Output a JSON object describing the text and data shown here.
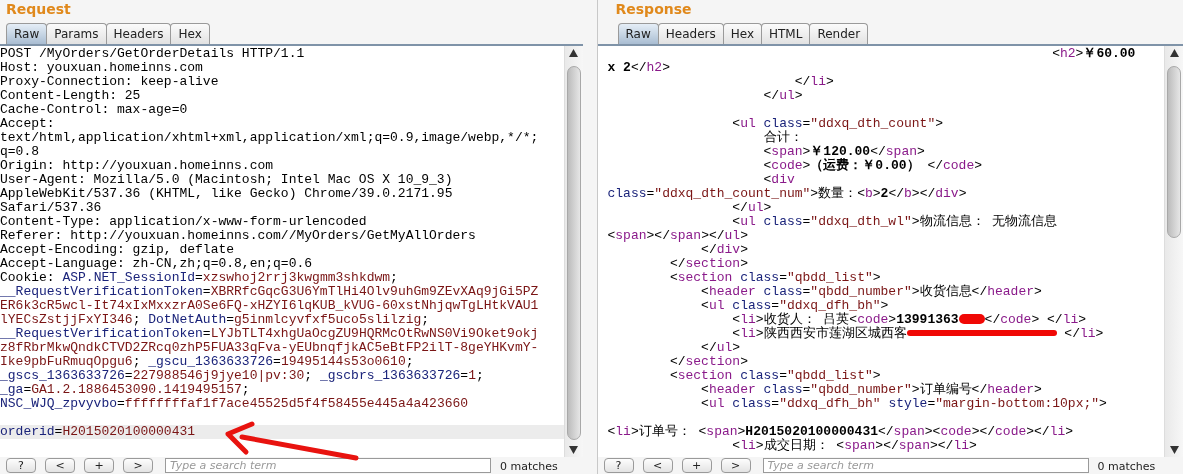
{
  "panels": [
    {
      "title": "Request",
      "tabs": [
        {
          "label": "Raw",
          "selected": true
        },
        {
          "label": "Params",
          "selected": false
        },
        {
          "label": "Headers",
          "selected": false
        },
        {
          "label": "Hex",
          "selected": false
        }
      ],
      "lines": [
        {
          "kind": "code",
          "highlighted": false,
          "tokens": [
            {
              "kind": "plain",
              "text": "POST /MyOrders/GetOrderDetails HTTP/1.1"
            }
          ]
        },
        {
          "kind": "code",
          "highlighted": false,
          "tokens": [
            {
              "kind": "plain",
              "text": "Host: youxuan.homeinns.com"
            }
          ]
        },
        {
          "kind": "code",
          "highlighted": false,
          "tokens": [
            {
              "kind": "plain",
              "text": "Proxy-Connection: keep-alive"
            }
          ]
        },
        {
          "kind": "code",
          "highlighted": false,
          "tokens": [
            {
              "kind": "plain",
              "text": "Content-Length: 25"
            }
          ]
        },
        {
          "kind": "code",
          "highlighted": false,
          "tokens": [
            {
              "kind": "plain",
              "text": "Cache-Control: max-age=0"
            }
          ]
        },
        {
          "kind": "code",
          "highlighted": false,
          "tokens": [
            {
              "kind": "plain",
              "text": "Accept:"
            }
          ]
        },
        {
          "kind": "code",
          "highlighted": false,
          "tokens": [
            {
              "kind": "plain",
              "text": "text/html,application/xhtml+xml,application/xml;q=0.9,image/webp,*/*;"
            }
          ]
        },
        {
          "kind": "code",
          "highlighted": false,
          "tokens": [
            {
              "kind": "plain",
              "text": "q=0.8"
            }
          ]
        },
        {
          "kind": "code",
          "highlighted": false,
          "tokens": [
            {
              "kind": "plain",
              "text": "Origin: http://youxuan.homeinns.com"
            }
          ]
        },
        {
          "kind": "code",
          "highlighted": false,
          "tokens": [
            {
              "kind": "plain",
              "text": "User-Agent: Mozilla/5.0 (Macintosh; Intel Mac OS X 10_9_3)"
            }
          ]
        },
        {
          "kind": "code",
          "highlighted": false,
          "tokens": [
            {
              "kind": "plain",
              "text": "AppleWebKit/537.36 (KHTML, like Gecko) Chrome/39.0.2171.95"
            }
          ]
        },
        {
          "kind": "code",
          "highlighted": false,
          "tokens": [
            {
              "kind": "plain",
              "text": "Safari/537.36"
            }
          ]
        },
        {
          "kind": "code",
          "highlighted": false,
          "tokens": [
            {
              "kind": "plain",
              "text": "Content-Type: application/x-www-form-urlencoded"
            }
          ]
        },
        {
          "kind": "code",
          "highlighted": false,
          "tokens": [
            {
              "kind": "plain",
              "text": "Referer: http://youxuan.homeinns.com//MyOrders/GetMyAllOrders"
            }
          ]
        },
        {
          "kind": "code",
          "highlighted": false,
          "tokens": [
            {
              "kind": "plain",
              "text": "Accept-Encoding: gzip, deflate"
            }
          ]
        },
        {
          "kind": "code",
          "highlighted": false,
          "tokens": [
            {
              "kind": "plain",
              "text": "Accept-Language: zh-CN,zh;q=0.8,en;q=0.6"
            }
          ]
        },
        {
          "kind": "code",
          "highlighted": false,
          "tokens": [
            {
              "kind": "plain",
              "text": "Cookie: "
            },
            {
              "kind": "name",
              "text": "ASP.NET_SessionId"
            },
            {
              "kind": "plain",
              "text": "="
            },
            {
              "kind": "value",
              "text": "xzswhoj2rrj3kwgmm3shkdwm"
            },
            {
              "kind": "plain",
              "text": ";"
            }
          ]
        },
        {
          "kind": "code",
          "highlighted": false,
          "tokens": [
            {
              "kind": "name",
              "text": "__RequestVerificationToken"
            },
            {
              "kind": "plain",
              "text": "="
            },
            {
              "kind": "value",
              "text": "XBRRfcGqcG3U6YmTlHi4Olv9uhGm9ZEvXAq9jGi5PZ"
            }
          ]
        },
        {
          "kind": "code",
          "highlighted": false,
          "tokens": [
            {
              "kind": "value",
              "text": "ER6k3cR5wcl-It74xIxMxxzrA0Se6FQ-xHZYI6lqKUB_kVUG-60xstNhjqwTgLHtkVAU1"
            }
          ]
        },
        {
          "kind": "code",
          "highlighted": false,
          "tokens": [
            {
              "kind": "value",
              "text": "lYECsZstjjFxYI346"
            },
            {
              "kind": "plain",
              "text": "; "
            },
            {
              "kind": "name",
              "text": "DotNetAuth"
            },
            {
              "kind": "plain",
              "text": "="
            },
            {
              "kind": "value",
              "text": "g5inmlcyvfxf5uco5slilzig"
            },
            {
              "kind": "plain",
              "text": ";"
            }
          ]
        },
        {
          "kind": "code",
          "highlighted": false,
          "tokens": [
            {
              "kind": "name",
              "text": "__RequestVerificationToken"
            },
            {
              "kind": "plain",
              "text": "="
            },
            {
              "kind": "value",
              "text": "LYJbTLT4xhgUaOcgZU9HQRMcOtRwNS0Vi9Oket9okj"
            }
          ]
        },
        {
          "kind": "code",
          "highlighted": false,
          "tokens": [
            {
              "kind": "value",
              "text": "z8fRbrMkwQndkCTVD2ZRcq0zhP5FUA33qFva-yEUbnqfjkAC5eBtFP2ilT-8geYHKvmY-"
            }
          ]
        },
        {
          "kind": "code",
          "highlighted": false,
          "tokens": [
            {
              "kind": "value",
              "text": "Ike9pbFuRmuqOpgu6"
            },
            {
              "kind": "plain",
              "text": "; "
            },
            {
              "kind": "name",
              "text": "_gscu_1363633726"
            },
            {
              "kind": "plain",
              "text": "="
            },
            {
              "kind": "value",
              "text": "19495144s53o0610"
            },
            {
              "kind": "plain",
              "text": ";"
            }
          ]
        },
        {
          "kind": "code",
          "highlighted": false,
          "tokens": [
            {
              "kind": "name",
              "text": "_gscs_1363633726"
            },
            {
              "kind": "plain",
              "text": "="
            },
            {
              "kind": "value",
              "text": "227988546j9jye10|pv:30"
            },
            {
              "kind": "plain",
              "text": "; "
            },
            {
              "kind": "name",
              "text": "_gscbrs_1363633726"
            },
            {
              "kind": "plain",
              "text": "="
            },
            {
              "kind": "value",
              "text": "1"
            },
            {
              "kind": "plain",
              "text": ";"
            }
          ]
        },
        {
          "kind": "code",
          "highlighted": false,
          "tokens": [
            {
              "kind": "name",
              "text": "_ga"
            },
            {
              "kind": "plain",
              "text": "="
            },
            {
              "kind": "value",
              "text": "GA1.2.1886453090.1419495157"
            },
            {
              "kind": "plain",
              "text": ";"
            }
          ]
        },
        {
          "kind": "code",
          "highlighted": false,
          "tokens": [
            {
              "kind": "name",
              "text": "NSC_WJQ_zpvyvbo"
            },
            {
              "kind": "plain",
              "text": "="
            },
            {
              "kind": "value",
              "text": "ffffffffaf1f7ace45525d5f4f58455e445a4a423660"
            }
          ]
        },
        {
          "kind": "blank"
        },
        {
          "kind": "code",
          "highlighted": true,
          "tokens": [
            {
              "kind": "name",
              "text": "orderid"
            },
            {
              "kind": "plain",
              "text": "="
            },
            {
              "kind": "value",
              "text": "H2015020100000431"
            }
          ]
        }
      ],
      "buttons": [
        "?",
        "<",
        "+",
        ">"
      ],
      "search": {
        "placeholder": "Type a search term"
      },
      "matches": "0 matches"
    },
    {
      "title": "Response",
      "tabs": [
        {
          "label": "Raw",
          "selected": true
        },
        {
          "label": "Headers",
          "selected": false
        },
        {
          "label": "Hex",
          "selected": false
        },
        {
          "label": "HTML",
          "selected": false
        },
        {
          "label": "Render",
          "selected": false
        }
      ],
      "lines": [
        {
          "kind": "code",
          "highlighted": false,
          "tokens": [
            {
              "kind": "plain",
              "text": "                                                         <"
            },
            {
              "kind": "tag",
              "text": "h2"
            },
            {
              "kind": "plain",
              "text": ">"
            },
            {
              "kind": "bold",
              "text": "￥60.00"
            }
          ]
        },
        {
          "kind": "code",
          "highlighted": false,
          "tokens": [
            {
              "kind": "bold",
              "text": "x 2"
            },
            {
              "kind": "plain",
              "text": "</"
            },
            {
              "kind": "tag",
              "text": "h2"
            },
            {
              "kind": "plain",
              "text": ">"
            }
          ]
        },
        {
          "kind": "code",
          "highlighted": false,
          "tokens": [
            {
              "kind": "plain",
              "text": "                        </"
            },
            {
              "kind": "tag",
              "text": "li"
            },
            {
              "kind": "plain",
              "text": ">"
            }
          ]
        },
        {
          "kind": "code",
          "highlighted": false,
          "tokens": [
            {
              "kind": "plain",
              "text": "                    </"
            },
            {
              "kind": "tag",
              "text": "ul"
            },
            {
              "kind": "plain",
              "text": ">"
            }
          ]
        },
        {
          "kind": "blank"
        },
        {
          "kind": "code",
          "highlighted": false,
          "tokens": [
            {
              "kind": "plain",
              "text": "                <"
            },
            {
              "kind": "tag",
              "text": "ul"
            },
            {
              "kind": "name",
              "text": " class"
            },
            {
              "kind": "plain",
              "text": "="
            },
            {
              "kind": "value",
              "text": "\"ddxq_dth_count\""
            },
            {
              "kind": "plain",
              "text": ">"
            }
          ]
        },
        {
          "kind": "code",
          "highlighted": false,
          "tokens": [
            {
              "kind": "plain",
              "text": "                    合计："
            }
          ]
        },
        {
          "kind": "code",
          "highlighted": false,
          "tokens": [
            {
              "kind": "plain",
              "text": "                    <"
            },
            {
              "kind": "tag",
              "text": "span"
            },
            {
              "kind": "plain",
              "text": ">"
            },
            {
              "kind": "bold",
              "text": "￥120.00"
            },
            {
              "kind": "plain",
              "text": "</"
            },
            {
              "kind": "tag",
              "text": "span"
            },
            {
              "kind": "plain",
              "text": ">"
            }
          ]
        },
        {
          "kind": "code",
          "highlighted": false,
          "tokens": [
            {
              "kind": "plain",
              "text": "                    <"
            },
            {
              "kind": "tag",
              "text": "code"
            },
            {
              "kind": "plain",
              "text": ">"
            },
            {
              "kind": "bold",
              "text": "（运费：￥0.00）"
            },
            {
              "kind": "plain",
              "text": " </"
            },
            {
              "kind": "tag",
              "text": "code"
            },
            {
              "kind": "plain",
              "text": ">"
            }
          ]
        },
        {
          "kind": "code",
          "highlighted": false,
          "tokens": [
            {
              "kind": "plain",
              "text": "                    <"
            },
            {
              "kind": "tag",
              "text": "div"
            }
          ]
        },
        {
          "kind": "code",
          "highlighted": false,
          "tokens": [
            {
              "kind": "name",
              "text": "class"
            },
            {
              "kind": "plain",
              "text": "="
            },
            {
              "kind": "value",
              "text": "\"ddxq_dth_count_num\""
            },
            {
              "kind": "plain",
              "text": ">数量：<"
            },
            {
              "kind": "tag",
              "text": "b"
            },
            {
              "kind": "plain",
              "text": ">"
            },
            {
              "kind": "bold",
              "text": "2"
            },
            {
              "kind": "plain",
              "text": "</"
            },
            {
              "kind": "tag",
              "text": "b"
            },
            {
              "kind": "plain",
              "text": "></"
            },
            {
              "kind": "tag",
              "text": "div"
            },
            {
              "kind": "plain",
              "text": ">"
            }
          ]
        },
        {
          "kind": "code",
          "highlighted": false,
          "tokens": [
            {
              "kind": "plain",
              "text": "                </"
            },
            {
              "kind": "tag",
              "text": "ul"
            },
            {
              "kind": "plain",
              "text": ">"
            }
          ]
        },
        {
          "kind": "code",
          "highlighted": false,
          "tokens": [
            {
              "kind": "plain",
              "text": "                <"
            },
            {
              "kind": "tag",
              "text": "ul"
            },
            {
              "kind": "name",
              "text": " class"
            },
            {
              "kind": "plain",
              "text": "="
            },
            {
              "kind": "value",
              "text": "\"ddxq_dth_wl\""
            },
            {
              "kind": "plain",
              "text": ">物流信息： 无物流信息"
            }
          ]
        },
        {
          "kind": "code",
          "highlighted": false,
          "tokens": [
            {
              "kind": "plain",
              "text": "<"
            },
            {
              "kind": "tag",
              "text": "span"
            },
            {
              "kind": "plain",
              "text": "></"
            },
            {
              "kind": "tag",
              "text": "span"
            },
            {
              "kind": "plain",
              "text": "></"
            },
            {
              "kind": "tag",
              "text": "ul"
            },
            {
              "kind": "plain",
              "text": ">"
            }
          ]
        },
        {
          "kind": "code",
          "highlighted": false,
          "tokens": [
            {
              "kind": "plain",
              "text": "            </"
            },
            {
              "kind": "tag",
              "text": "div"
            },
            {
              "kind": "plain",
              "text": ">"
            }
          ]
        },
        {
          "kind": "code",
          "highlighted": false,
          "tokens": [
            {
              "kind": "plain",
              "text": "        </"
            },
            {
              "kind": "tag",
              "text": "section"
            },
            {
              "kind": "plain",
              "text": ">"
            }
          ]
        },
        {
          "kind": "code",
          "highlighted": false,
          "tokens": [
            {
              "kind": "plain",
              "text": "        <"
            },
            {
              "kind": "tag",
              "text": "section"
            },
            {
              "kind": "name",
              "text": " class"
            },
            {
              "kind": "plain",
              "text": "="
            },
            {
              "kind": "value",
              "text": "\"qbdd_list\""
            },
            {
              "kind": "plain",
              "text": ">"
            }
          ]
        },
        {
          "kind": "code",
          "highlighted": false,
          "tokens": [
            {
              "kind": "plain",
              "text": "            <"
            },
            {
              "kind": "tag",
              "text": "header"
            },
            {
              "kind": "name",
              "text": " class"
            },
            {
              "kind": "plain",
              "text": "="
            },
            {
              "kind": "value",
              "text": "\"qbdd_number\""
            },
            {
              "kind": "plain",
              "text": ">收货信息</"
            },
            {
              "kind": "tag",
              "text": "header"
            },
            {
              "kind": "plain",
              "text": ">"
            }
          ]
        },
        {
          "kind": "code",
          "highlighted": false,
          "tokens": [
            {
              "kind": "plain",
              "text": "            <"
            },
            {
              "kind": "tag",
              "text": "ul"
            },
            {
              "kind": "name",
              "text": " class"
            },
            {
              "kind": "plain",
              "text": "="
            },
            {
              "kind": "value",
              "text": "\"ddxq_dfh_bh\""
            },
            {
              "kind": "plain",
              "text": ">"
            }
          ]
        },
        {
          "kind": "code",
          "highlighted": false,
          "tokens": [
            {
              "kind": "plain",
              "text": "                <"
            },
            {
              "kind": "tag",
              "text": "li"
            },
            {
              "kind": "plain",
              "text": ">收货人： 吕英<"
            },
            {
              "kind": "tag",
              "text": "code"
            },
            {
              "kind": "plain",
              "text": ">"
            },
            {
              "kind": "bold",
              "text": "13991363"
            },
            {
              "kind": "blob"
            },
            {
              "kind": "plain",
              "text": "</"
            },
            {
              "kind": "tag",
              "text": "code"
            },
            {
              "kind": "plain",
              "text": "> </"
            },
            {
              "kind": "tag",
              "text": "li"
            },
            {
              "kind": "plain",
              "text": ">"
            }
          ]
        },
        {
          "kind": "code",
          "highlighted": false,
          "tokens": [
            {
              "kind": "plain",
              "text": "                <"
            },
            {
              "kind": "tag",
              "text": "li"
            },
            {
              "kind": "plain",
              "text": ">陕西西安市莲湖区城西客"
            },
            {
              "kind": "stroke"
            },
            {
              "kind": "plain",
              "text": " </"
            },
            {
              "kind": "tag",
              "text": "li"
            },
            {
              "kind": "plain",
              "text": ">"
            }
          ]
        },
        {
          "kind": "code",
          "highlighted": false,
          "tokens": [
            {
              "kind": "plain",
              "text": "            </"
            },
            {
              "kind": "tag",
              "text": "ul"
            },
            {
              "kind": "plain",
              "text": ">"
            }
          ]
        },
        {
          "kind": "code",
          "highlighted": false,
          "tokens": [
            {
              "kind": "plain",
              "text": "        </"
            },
            {
              "kind": "tag",
              "text": "section"
            },
            {
              "kind": "plain",
              "text": ">"
            }
          ]
        },
        {
          "kind": "code",
          "highlighted": false,
          "tokens": [
            {
              "kind": "plain",
              "text": "        <"
            },
            {
              "kind": "tag",
              "text": "section"
            },
            {
              "kind": "name",
              "text": " class"
            },
            {
              "kind": "plain",
              "text": "="
            },
            {
              "kind": "value",
              "text": "\"qbdd_list\""
            },
            {
              "kind": "plain",
              "text": ">"
            }
          ]
        },
        {
          "kind": "code",
          "highlighted": false,
          "tokens": [
            {
              "kind": "plain",
              "text": "            <"
            },
            {
              "kind": "tag",
              "text": "header"
            },
            {
              "kind": "name",
              "text": " class"
            },
            {
              "kind": "plain",
              "text": "="
            },
            {
              "kind": "value",
              "text": "\"qbdd_number\""
            },
            {
              "kind": "plain",
              "text": ">订单编号</"
            },
            {
              "kind": "tag",
              "text": "header"
            },
            {
              "kind": "plain",
              "text": ">"
            }
          ]
        },
        {
          "kind": "code",
          "highlighted": false,
          "tokens": [
            {
              "kind": "plain",
              "text": "            <"
            },
            {
              "kind": "tag",
              "text": "ul"
            },
            {
              "kind": "name",
              "text": " class"
            },
            {
              "kind": "plain",
              "text": "="
            },
            {
              "kind": "value",
              "text": "\"ddxq_dfh_bh\""
            },
            {
              "kind": "name",
              "text": " style"
            },
            {
              "kind": "plain",
              "text": "="
            },
            {
              "kind": "value",
              "text": "\"margin-bottom:10px;\""
            },
            {
              "kind": "plain",
              "text": ">"
            }
          ]
        },
        {
          "kind": "blank"
        },
        {
          "kind": "code",
          "highlighted": false,
          "tokens": [
            {
              "kind": "plain",
              "text": "<"
            },
            {
              "kind": "tag",
              "text": "li"
            },
            {
              "kind": "plain",
              "text": ">订单号： <"
            },
            {
              "kind": "tag",
              "text": "span"
            },
            {
              "kind": "plain",
              "text": ">"
            },
            {
              "kind": "bold",
              "text": "H2015020100000431"
            },
            {
              "kind": "plain",
              "text": "</"
            },
            {
              "kind": "tag",
              "text": "span"
            },
            {
              "kind": "plain",
              "text": "><"
            },
            {
              "kind": "tag",
              "text": "code"
            },
            {
              "kind": "plain",
              "text": "></"
            },
            {
              "kind": "tag",
              "text": "code"
            },
            {
              "kind": "plain",
              "text": "></"
            },
            {
              "kind": "tag",
              "text": "li"
            },
            {
              "kind": "plain",
              "text": ">"
            }
          ]
        },
        {
          "kind": "code",
          "highlighted": false,
          "tokens": [
            {
              "kind": "plain",
              "text": "                <"
            },
            {
              "kind": "tag",
              "text": "li"
            },
            {
              "kind": "plain",
              "text": ">成交日期： <"
            },
            {
              "kind": "tag",
              "text": "span"
            },
            {
              "kind": "plain",
              "text": "></"
            },
            {
              "kind": "tag",
              "text": "span"
            },
            {
              "kind": "plain",
              "text": "></"
            },
            {
              "kind": "tag",
              "text": "li"
            },
            {
              "kind": "plain",
              "text": ">"
            }
          ]
        }
      ],
      "buttons": [
        "?",
        "<",
        "+",
        ">"
      ],
      "search": {
        "placeholder": "Type a search term"
      },
      "matches": "0 matches"
    }
  ]
}
